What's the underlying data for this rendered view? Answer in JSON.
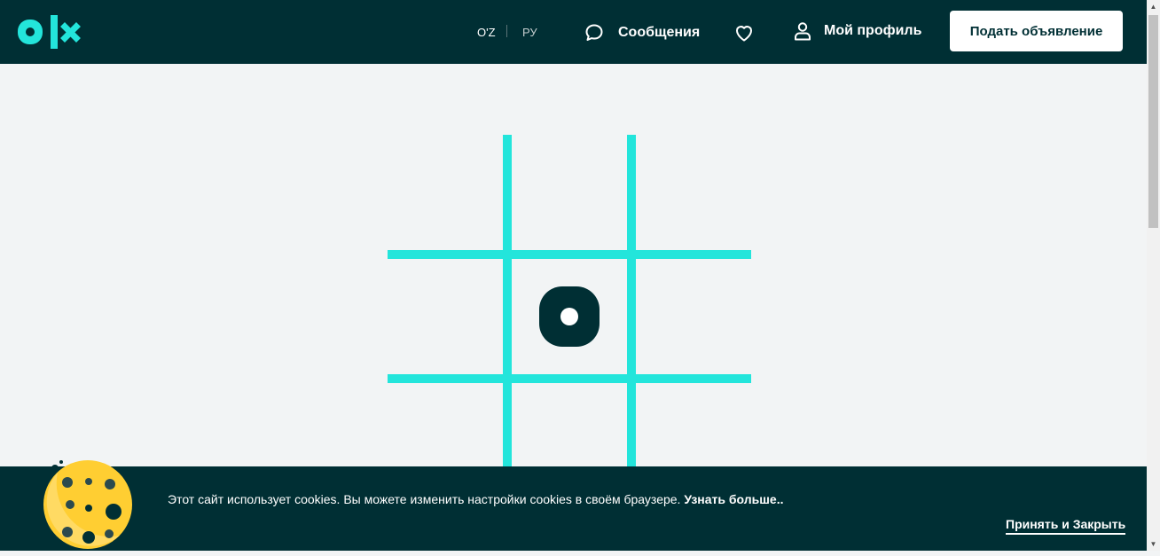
{
  "header": {
    "logo_text": "olx",
    "languages": [
      {
        "label": "O'Z",
        "active": true
      },
      {
        "label": "РУ",
        "active": false
      }
    ],
    "messages_label": "Сообщения",
    "profile_label": "Мой профиль",
    "post_ad_label": "Подать объявление"
  },
  "illustration": {
    "type": "tic-tac-toe grid",
    "center_mark": "o"
  },
  "cookie_bar": {
    "text": "Этот сайт использует cookies. Вы можете изменить настройки cookies в своём браузере.",
    "learn_more": "Узнать больше..",
    "accept_label": "Принять и Закрыть"
  },
  "colors": {
    "header_bg": "#002f34",
    "page_bg": "#f2f4f5",
    "accent": "#23e5db",
    "white": "#ffffff",
    "cookie_yellow": "#ffce32"
  },
  "icons": [
    "chat-bubble-icon",
    "heart-icon",
    "user-icon",
    "cookie-icon"
  ]
}
